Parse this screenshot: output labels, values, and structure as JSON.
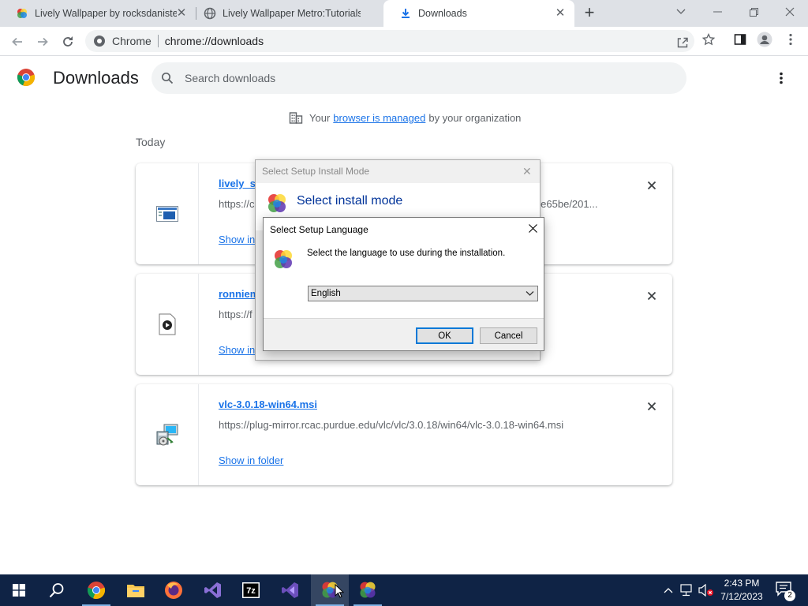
{
  "browser": {
    "tabs": [
      {
        "title": "Lively Wallpaper by rocksdanister",
        "icon": "lively-icon",
        "active": false
      },
      {
        "title": "Lively Wallpaper Metro:Tutorials",
        "icon": "globe-icon",
        "active": false
      },
      {
        "title": "Downloads",
        "icon": "download-icon",
        "active": true
      }
    ],
    "omnibox": {
      "site_label": "Chrome",
      "url": "chrome://downloads"
    }
  },
  "downloads": {
    "title": "Downloads",
    "search_placeholder": "Search downloads",
    "managed": {
      "prefix": "Your",
      "link": "browser is managed",
      "suffix": "by your organization"
    },
    "section": "Today",
    "items": [
      {
        "name": "lively_se",
        "url": "https://c",
        "url_tail": "t-2e65be/201...",
        "action": "Show in",
        "icon": "installer-icon"
      },
      {
        "name": "ronniem",
        "url": "https://f",
        "action": "Show in",
        "icon": "video-file-icon"
      },
      {
        "name": "vlc-3.0.18-win64.msi",
        "url": "https://plug-mirror.rcac.purdue.edu/vlc/vlc/3.0.18/win64/vlc-3.0.18-win64.msi",
        "action": "Show in folder",
        "icon": "msi-installer-icon"
      }
    ]
  },
  "dialog_install_mode": {
    "caption": "Select Setup Install Mode",
    "heading": "Select install mode"
  },
  "dialog_language": {
    "caption": "Select Setup Language",
    "prompt": "Select the language to use during the installation.",
    "selected_language": "English",
    "ok_label": "OK",
    "cancel_label": "Cancel"
  },
  "taskbar": {
    "time": "2:43 PM",
    "date": "7/12/2023",
    "notification_count": "2",
    "apps": [
      "windows-start-icon",
      "search-icon",
      "chrome-icon",
      "file-explorer-icon",
      "firefox-icon",
      "visual-studio-code-icon",
      "7zip-icon",
      "visual-studio-icon",
      "lively-setup-icon",
      "lively-setup-icon"
    ]
  },
  "colors": {
    "accent": "#1a73e8",
    "tabstrip": "#dee1e6",
    "taskbar": "#0f2345"
  }
}
